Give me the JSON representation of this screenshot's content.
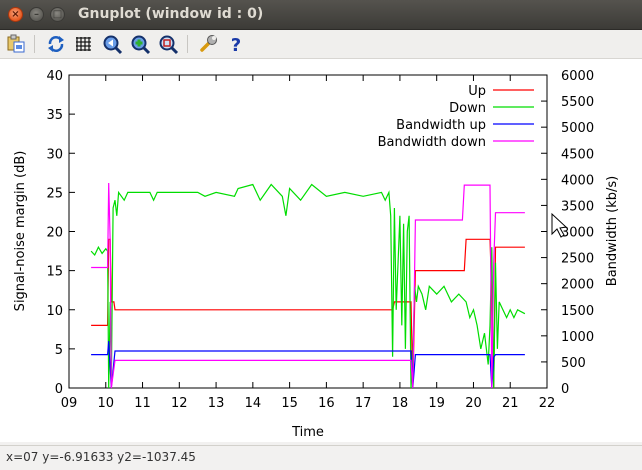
{
  "window": {
    "title": "Gnuplot (window id : 0)"
  },
  "titlebar_buttons": {
    "close": "×",
    "minimize": "–",
    "maximize": "□"
  },
  "toolbar": [
    {
      "name": "copy-to-clipboard-button",
      "icon": "clipboard-icon"
    },
    {
      "name": "replot-button",
      "icon": "refresh-icon"
    },
    {
      "name": "toggle-grid-button",
      "icon": "grid-icon"
    },
    {
      "name": "previous-zoom-button",
      "icon": "zoom-prev-icon"
    },
    {
      "name": "next-zoom-button",
      "icon": "zoom-next-icon"
    },
    {
      "name": "autoscale-button",
      "icon": "zoom-autoscale-icon"
    },
    {
      "name": "settings-button",
      "icon": "wrench-icon"
    },
    {
      "name": "help-button",
      "icon": "help-icon"
    }
  ],
  "status": "x=07 y=-6.91633 y2=-1037.45",
  "chart_data": {
    "type": "line",
    "xlabel": "Time",
    "ylabel": "Signal-noise margin (dB)",
    "y2label": "Bandwidth (kb/s)",
    "xlim": [
      9,
      22
    ],
    "ylim": [
      0,
      40
    ],
    "y2lim": [
      0,
      6000
    ],
    "xticks": [
      "09",
      "10",
      "11",
      "12",
      "13",
      "14",
      "15",
      "16",
      "17",
      "18",
      "19",
      "20",
      "21",
      "22"
    ],
    "yticks": [
      "0",
      "5",
      "10",
      "15",
      "20",
      "25",
      "30",
      "35",
      "40"
    ],
    "y2ticks": [
      "0",
      "500",
      "1000",
      "1500",
      "2000",
      "2500",
      "3000",
      "3500",
      "4000",
      "4500",
      "5000",
      "5500",
      "6000"
    ],
    "legend": "top-right",
    "series": [
      {
        "name": "Up",
        "axis": "y",
        "color": "#ff0000",
        "points": [
          [
            9.6,
            8
          ],
          [
            10.05,
            8
          ],
          [
            10.08,
            19
          ],
          [
            10.12,
            19
          ],
          [
            10.15,
            11
          ],
          [
            10.22,
            11
          ],
          [
            10.25,
            10
          ],
          [
            17.8,
            10
          ],
          [
            17.85,
            11
          ],
          [
            18.3,
            11
          ],
          [
            18.35,
            0
          ],
          [
            18.42,
            15
          ],
          [
            19.75,
            15
          ],
          [
            19.8,
            19
          ],
          [
            20.45,
            19
          ],
          [
            20.5,
            12
          ],
          [
            20.55,
            0
          ],
          [
            20.6,
            18
          ],
          [
            21.4,
            18
          ]
        ]
      },
      {
        "name": "Down",
        "axis": "y",
        "color": "#00dd00",
        "points": [
          [
            9.6,
            17.5
          ],
          [
            9.7,
            17
          ],
          [
            9.8,
            18
          ],
          [
            9.9,
            17.2
          ],
          [
            10.0,
            17.8
          ],
          [
            10.05,
            17.5
          ],
          [
            10.08,
            0
          ],
          [
            10.12,
            11
          ],
          [
            10.15,
            0
          ],
          [
            10.2,
            23
          ],
          [
            10.25,
            24
          ],
          [
            10.3,
            22
          ],
          [
            10.35,
            25
          ],
          [
            10.5,
            24
          ],
          [
            10.6,
            25
          ],
          [
            11.2,
            25
          ],
          [
            11.3,
            24
          ],
          [
            11.4,
            25
          ],
          [
            12.5,
            25
          ],
          [
            12.7,
            24.5
          ],
          [
            13.0,
            25
          ],
          [
            13.5,
            24.5
          ],
          [
            13.6,
            25.5
          ],
          [
            14.0,
            26
          ],
          [
            14.2,
            24
          ],
          [
            14.5,
            26
          ],
          [
            14.8,
            24.5
          ],
          [
            14.9,
            22
          ],
          [
            15.0,
            25.5
          ],
          [
            15.3,
            24
          ],
          [
            15.6,
            26
          ],
          [
            16.0,
            24.5
          ],
          [
            16.5,
            25
          ],
          [
            17.0,
            24.5
          ],
          [
            17.5,
            25
          ],
          [
            17.6,
            24
          ],
          [
            17.7,
            25
          ],
          [
            17.75,
            22
          ],
          [
            17.8,
            4
          ],
          [
            17.85,
            23
          ],
          [
            17.9,
            10
          ],
          [
            18.0,
            22
          ],
          [
            18.05,
            8
          ],
          [
            18.1,
            21
          ],
          [
            18.15,
            5
          ],
          [
            18.2,
            20
          ],
          [
            18.25,
            22
          ],
          [
            18.3,
            0
          ],
          [
            18.35,
            4
          ],
          [
            18.4,
            13
          ],
          [
            18.45,
            11
          ],
          [
            18.5,
            13
          ],
          [
            18.6,
            12
          ],
          [
            18.7,
            10
          ],
          [
            18.8,
            13
          ],
          [
            19.0,
            12
          ],
          [
            19.2,
            13
          ],
          [
            19.4,
            11
          ],
          [
            19.6,
            12
          ],
          [
            19.8,
            11
          ],
          [
            19.9,
            9
          ],
          [
            20.0,
            10
          ],
          [
            20.1,
            8
          ],
          [
            20.2,
            5
          ],
          [
            20.3,
            7
          ],
          [
            20.4,
            3
          ],
          [
            20.45,
            8
          ],
          [
            20.5,
            18
          ],
          [
            20.55,
            0
          ],
          [
            20.6,
            16
          ],
          [
            20.65,
            5
          ],
          [
            20.7,
            11
          ],
          [
            20.8,
            10
          ],
          [
            20.9,
            9
          ],
          [
            21.0,
            10
          ],
          [
            21.1,
            9
          ],
          [
            21.2,
            10
          ],
          [
            21.4,
            9.5
          ]
        ]
      },
      {
        "name": "Bandwidth up",
        "axis": "y2",
        "color": "#0000ff",
        "points": [
          [
            9.6,
            640
          ],
          [
            10.05,
            640
          ],
          [
            10.08,
            900
          ],
          [
            10.15,
            0
          ],
          [
            10.25,
            710
          ],
          [
            18.3,
            710
          ],
          [
            18.35,
            0
          ],
          [
            18.42,
            640
          ],
          [
            20.45,
            640
          ],
          [
            20.5,
            0
          ],
          [
            20.55,
            590
          ],
          [
            20.6,
            640
          ],
          [
            21.4,
            640
          ]
        ]
      },
      {
        "name": "Bandwidth down",
        "axis": "y2",
        "color": "#ff00ff",
        "points": [
          [
            9.6,
            2310
          ],
          [
            10.05,
            2310
          ],
          [
            10.08,
            3930
          ],
          [
            10.12,
            2800
          ],
          [
            10.15,
            0
          ],
          [
            10.25,
            530
          ],
          [
            18.3,
            530
          ],
          [
            18.35,
            0
          ],
          [
            18.42,
            3220
          ],
          [
            19.7,
            3220
          ],
          [
            19.75,
            3890
          ],
          [
            20.45,
            3890
          ],
          [
            20.5,
            0
          ],
          [
            20.55,
            2400
          ],
          [
            20.6,
            3360
          ],
          [
            21.4,
            3360
          ]
        ]
      }
    ]
  }
}
